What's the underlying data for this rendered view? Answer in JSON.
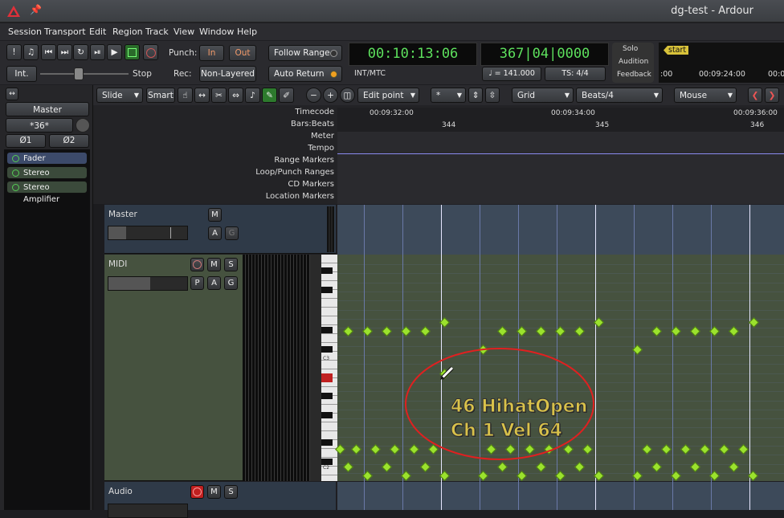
{
  "window": {
    "title": "dg-test - Ardour"
  },
  "menu": [
    "Session",
    "Transport",
    "Edit",
    "Region",
    "Track",
    "View",
    "Window",
    "Help"
  ],
  "transport": {
    "int_label": "Int.",
    "stop_label": "Stop",
    "punch_label": "Punch:",
    "punch_in": "In",
    "punch_out": "Out",
    "rec_label": "Rec:",
    "rec_mode": "Non-Layered",
    "follow_range": "Follow Range",
    "auto_return": "Auto Return",
    "clock_timecode": "00:10:13:06",
    "clock_source": "INT/MTC",
    "clock_bbt": "367|04|0000",
    "tempo": "♩ = 141.000",
    "meter": "TS: 4/4",
    "solo": "Solo",
    "audition": "Audition",
    "feedback": "Feedback",
    "mini_start": "start",
    "mini_t1": ":00",
    "mini_t2": "00:09:24:00",
    "mini_t3": "00:0"
  },
  "toolbar": {
    "edit_mode": "Slide",
    "smart": "Smart",
    "edit_point": "Edit point",
    "nudge": "*",
    "grid": "Grid",
    "grid_unit": "Beats/4",
    "mouse": "Mouse"
  },
  "editor_mixer": {
    "strip_name": "Master",
    "input_label": "*36*",
    "phase1": "Ø1",
    "phase2": "Ø2",
    "plugins": [
      "Fader",
      "Stereo Amplifier",
      "Stereo Amplifier"
    ]
  },
  "rulers": {
    "timecode_label": "Timecode",
    "bbt_label": "Bars:Beats",
    "meter_label": "Meter",
    "tempo_label": "Tempo",
    "range_label": "Range Markers",
    "loop_label": "Loop/Punch Ranges",
    "cd_label": "CD Markers",
    "location_label": "Location Markers",
    "tc1": "00:09:32:00",
    "tc2": "00:09:34:00",
    "tc3": "00:09:36:00",
    "bar1": "344",
    "bar2": "345",
    "bar3": "346"
  },
  "tracks": {
    "master_name": "Master",
    "midi_name": "MIDI",
    "audio_name": "Audio",
    "m": "M",
    "s": "S",
    "a": "A",
    "g": "G",
    "p": "P"
  },
  "piano": {
    "c3": "C3",
    "c2": "C2"
  },
  "tooltip": {
    "line1": "46 HihatOpen",
    "line2": "Ch 1 Vel 64"
  },
  "colors": {
    "accent_green": "#5de05d",
    "note_green": "#9be22d",
    "annotation_red": "#e02020",
    "midi_bg": "#46523f",
    "master_bg": "#3d4a5a"
  }
}
